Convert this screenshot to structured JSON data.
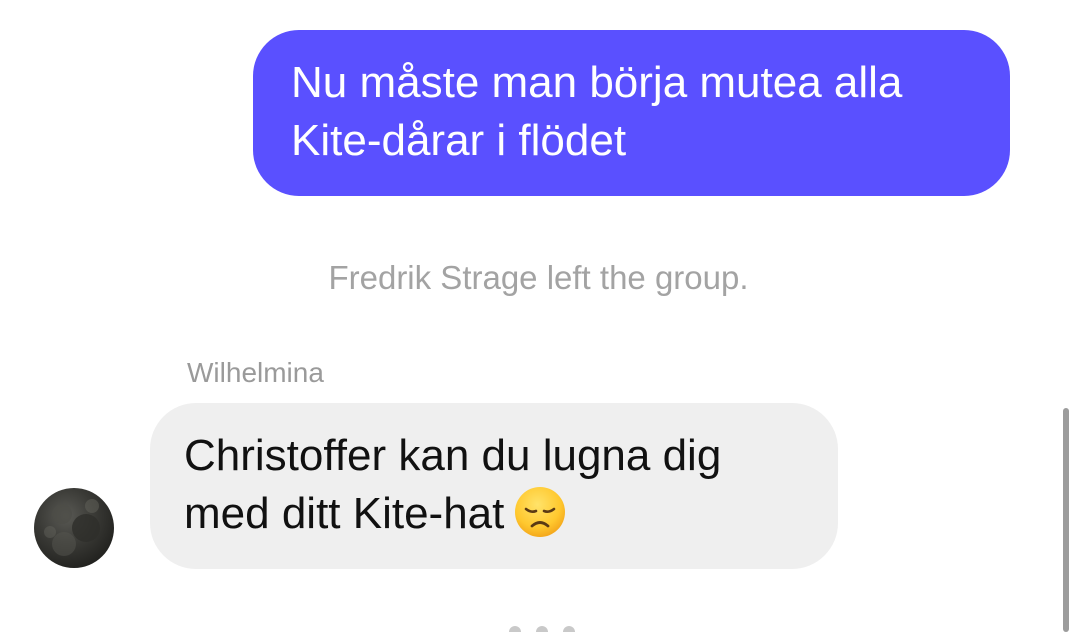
{
  "messages": {
    "outgoing": {
      "line1": "Nu måste man börja mutea alla",
      "line2": "Kite-dårar i flödet"
    },
    "system": "Fredrik Strage left the group.",
    "incoming": {
      "sender": "Wilhelmina",
      "line1": "Christoffer kan du lugna dig",
      "line2": "med ditt Kite-hat",
      "emoji": "disappointed-face-icon"
    }
  },
  "colors": {
    "outgoing_bubble": "#5a50ff",
    "incoming_bubble": "#efefef",
    "system_text": "#a3a3a3"
  }
}
